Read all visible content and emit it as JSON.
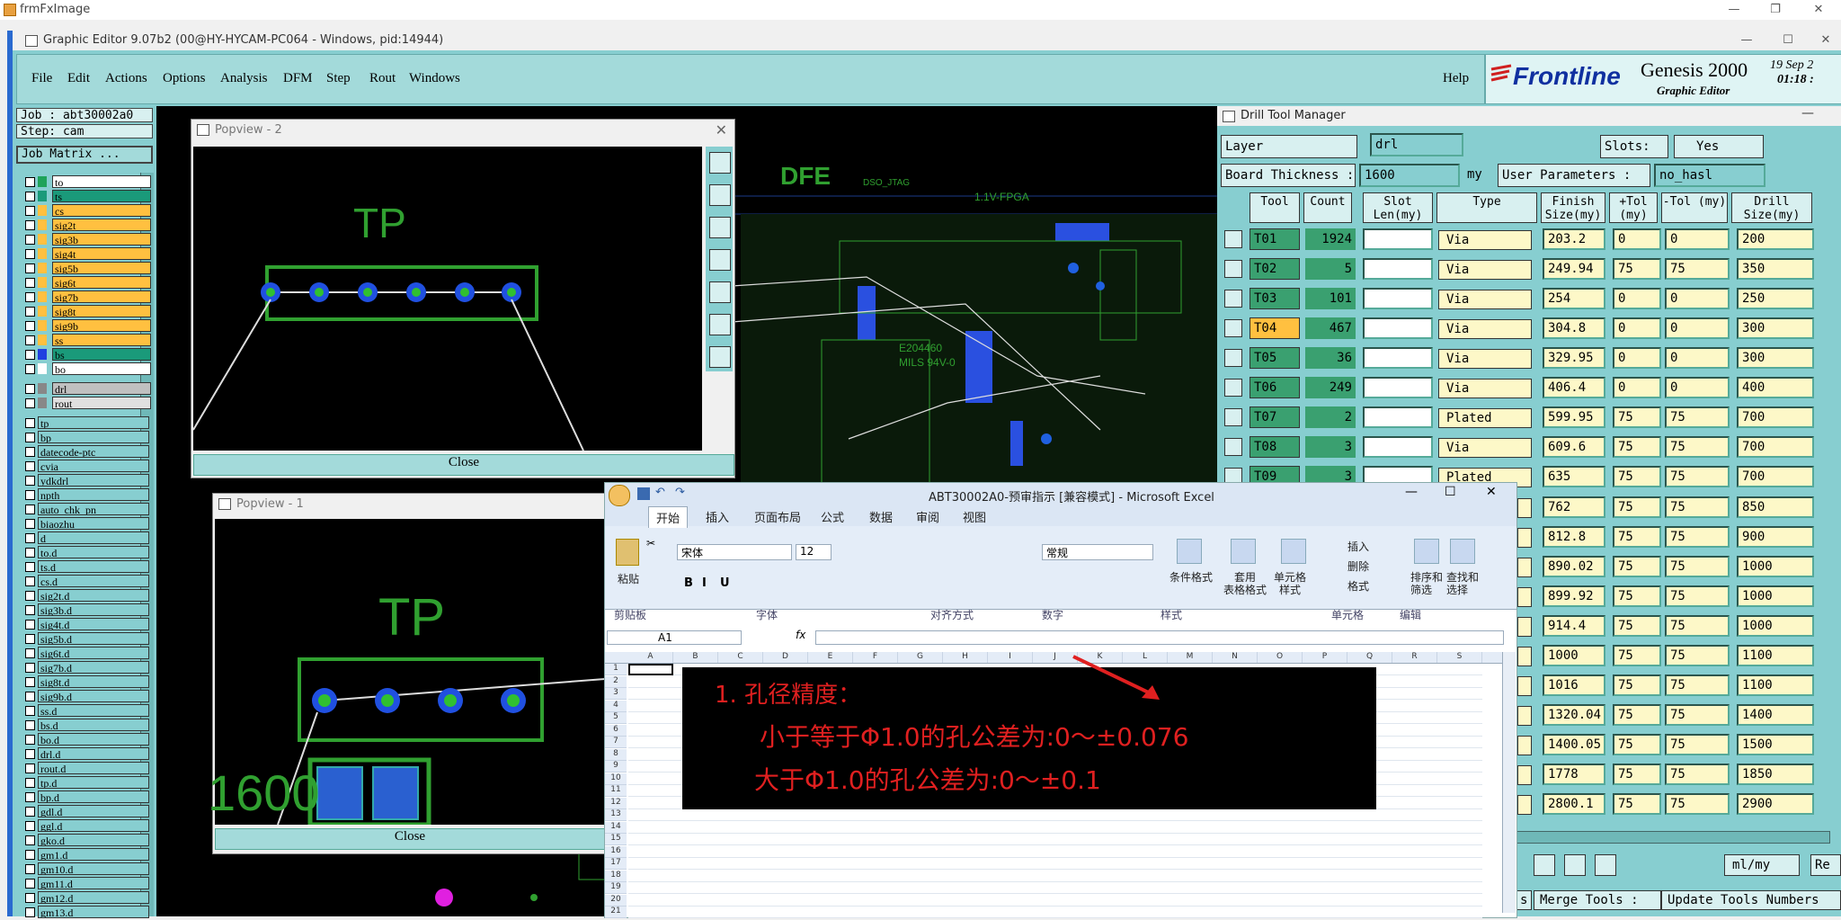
{
  "outer_window": {
    "title": "frmFxImage"
  },
  "app": {
    "title": "Graphic Editor 9.07b2 (00@HY-HYCAM-PC064 - Windows, pid:14944)",
    "menu": [
      "File",
      "Edit",
      "Actions",
      "Options",
      "Analysis",
      "DFM",
      "Step",
      "Rout",
      "Windows"
    ],
    "help": "Help",
    "logo": {
      "brand": "Frontline",
      "product": "Genesis 2000",
      "subtitle": "Graphic Editor",
      "date": "19 Sep 2",
      "time": "01:18 :"
    }
  },
  "left_panel": {
    "job": "Job : abt30002a0",
    "step": "Step: cam",
    "job_matrix": "Job Matrix ...",
    "layers": [
      {
        "name": "to",
        "color": "#1fa35a",
        "bg": "#ffffff"
      },
      {
        "name": "ts",
        "color": "#1a9a7a",
        "bg": "#1a9a7a"
      },
      {
        "name": "cs",
        "color": "#ffc040",
        "bg": "#ffc040"
      },
      {
        "name": "sig2t",
        "color": "#ffc040",
        "bg": "#ffc040"
      },
      {
        "name": "sig3b",
        "color": "#ffc040",
        "bg": "#ffc040"
      },
      {
        "name": "sig4t",
        "color": "#ffc040",
        "bg": "#ffc040"
      },
      {
        "name": "sig5b",
        "color": "#ffc040",
        "bg": "#ffc040"
      },
      {
        "name": "sig6t",
        "color": "#ffc040",
        "bg": "#ffc040"
      },
      {
        "name": "sig7b",
        "color": "#ffc040",
        "bg": "#ffc040"
      },
      {
        "name": "sig8t",
        "color": "#ffc040",
        "bg": "#ffc040"
      },
      {
        "name": "sig9b",
        "color": "#ffc040",
        "bg": "#ffc040"
      },
      {
        "name": "ss",
        "color": "#ffc040",
        "bg": "#ffc040"
      },
      {
        "name": "bs",
        "color": "#2040e0",
        "bg": "#1a9a7a"
      },
      {
        "name": "bo",
        "color": "#ffffff",
        "bg": "#ffffff"
      },
      {
        "name": "drl",
        "color": "#888888",
        "bg": "#c0c0c0"
      },
      {
        "name": "rout",
        "color": "#888888",
        "bg": "#e0e0e0"
      },
      {
        "name": "tp",
        "color": "",
        "bg": "#87ced0"
      },
      {
        "name": "bp",
        "color": "",
        "bg": "#87ced0"
      },
      {
        "name": "datecode-ptc",
        "color": "",
        "bg": "#87ced0"
      },
      {
        "name": "cvia",
        "color": "",
        "bg": "#87ced0"
      },
      {
        "name": "ydkdrl",
        "color": "",
        "bg": "#87ced0"
      },
      {
        "name": "npth",
        "color": "",
        "bg": "#87ced0"
      },
      {
        "name": "auto_chk_pn",
        "color": "",
        "bg": "#87ced0"
      },
      {
        "name": "biaozhu",
        "color": "",
        "bg": "#87ced0"
      },
      {
        "name": "d",
        "color": "",
        "bg": "#87ced0"
      },
      {
        "name": "to.d",
        "color": "",
        "bg": "#87ced0"
      },
      {
        "name": "ts.d",
        "color": "",
        "bg": "#87ced0"
      },
      {
        "name": "cs.d",
        "color": "",
        "bg": "#87ced0"
      },
      {
        "name": "sig2t.d",
        "color": "",
        "bg": "#87ced0"
      },
      {
        "name": "sig3b.d",
        "color": "",
        "bg": "#87ced0"
      },
      {
        "name": "sig4t.d",
        "color": "",
        "bg": "#87ced0"
      },
      {
        "name": "sig5b.d",
        "color": "",
        "bg": "#87ced0"
      },
      {
        "name": "sig6t.d",
        "color": "",
        "bg": "#87ced0"
      },
      {
        "name": "sig7b.d",
        "color": "",
        "bg": "#87ced0"
      },
      {
        "name": "sig8t.d",
        "color": "",
        "bg": "#87ced0"
      },
      {
        "name": "sig9b.d",
        "color": "",
        "bg": "#87ced0"
      },
      {
        "name": "ss.d",
        "color": "",
        "bg": "#87ced0"
      },
      {
        "name": "bs.d",
        "color": "",
        "bg": "#87ced0"
      },
      {
        "name": "bo.d",
        "color": "",
        "bg": "#87ced0"
      },
      {
        "name": "drl.d",
        "color": "",
        "bg": "#87ced0"
      },
      {
        "name": "rout.d",
        "color": "",
        "bg": "#87ced0"
      },
      {
        "name": "tp.d",
        "color": "",
        "bg": "#87ced0"
      },
      {
        "name": "bp.d",
        "color": "",
        "bg": "#87ced0"
      },
      {
        "name": "gdl.d",
        "color": "",
        "bg": "#87ced0"
      },
      {
        "name": "ggl.d",
        "color": "",
        "bg": "#87ced0"
      },
      {
        "name": "gko.d",
        "color": "",
        "bg": "#87ced0"
      },
      {
        "name": "gm1.d",
        "color": "",
        "bg": "#87ced0"
      },
      {
        "name": "gm10.d",
        "color": "",
        "bg": "#87ced0"
      },
      {
        "name": "gm11.d",
        "color": "",
        "bg": "#87ced0"
      },
      {
        "name": "gm12.d",
        "color": "",
        "bg": "#87ced0"
      },
      {
        "name": "gm13.d",
        "color": "",
        "bg": "#87ced0"
      }
    ]
  },
  "popview2": {
    "title": "Popview - 2",
    "label": "TP",
    "close": "Close"
  },
  "popview1": {
    "title": "Popview - 1",
    "label": "TP",
    "text_1600": "1600",
    "close": "Close"
  },
  "board_text": {
    "logo": "DFE",
    "ul": "E204460",
    "ul2": "MILS 94V-0",
    "fpga": "1.1V-FPGA",
    "jtag": "DSO_JTAG"
  },
  "drill_tool_manager": {
    "title": "Drill Tool Manager",
    "layer_label": "Layer",
    "layer_value": "drl",
    "slots_label": "Slots:",
    "slots_value": "Yes",
    "board_thickness_label": "Board Thickness :",
    "board_thickness_value": "1600",
    "board_thickness_unit": "my",
    "user_params_label": "User Parameters :",
    "user_params_value": "no_hasl",
    "headers": [
      "Tool",
      "Count",
      "Slot Len(my)",
      "Type",
      "Finish Size(my)",
      "+Tol (my)",
      "-Tol (my)",
      "Drill Size(my)"
    ],
    "rows": [
      {
        "tool": "T01",
        "count": "1924",
        "type": "Via",
        "finish": "203.2",
        "ptol": "0",
        "ntol": "0",
        "drill": "200"
      },
      {
        "tool": "T02",
        "count": "5",
        "type": "Via",
        "finish": "249.94",
        "ptol": "75",
        "ntol": "75",
        "drill": "350"
      },
      {
        "tool": "T03",
        "count": "101",
        "type": "Via",
        "finish": "254",
        "ptol": "0",
        "ntol": "0",
        "drill": "250"
      },
      {
        "tool": "T04",
        "count": "467",
        "type": "Via",
        "finish": "304.8",
        "ptol": "0",
        "ntol": "0",
        "drill": "300"
      },
      {
        "tool": "T05",
        "count": "36",
        "type": "Via",
        "finish": "329.95",
        "ptol": "0",
        "ntol": "0",
        "drill": "300"
      },
      {
        "tool": "T06",
        "count": "249",
        "type": "Via",
        "finish": "406.4",
        "ptol": "0",
        "ntol": "0",
        "drill": "400"
      },
      {
        "tool": "T07",
        "count": "2",
        "type": "Plated",
        "finish": "599.95",
        "ptol": "75",
        "ntol": "75",
        "drill": "700"
      },
      {
        "tool": "T08",
        "count": "3",
        "type": "Via",
        "finish": "609.6",
        "ptol": "75",
        "ntol": "75",
        "drill": "700"
      },
      {
        "tool": "T09",
        "count": "3",
        "type": "Plated",
        "finish": "635",
        "ptol": "75",
        "ntol": "75",
        "drill": "700"
      }
    ],
    "hidden_rows": [
      {
        "finish": "762",
        "ptol": "75",
        "ntol": "75",
        "drill": "850"
      },
      {
        "finish": "812.8",
        "ptol": "75",
        "ntol": "75",
        "drill": "900"
      },
      {
        "finish": "890.02",
        "ptol": "75",
        "ntol": "75",
        "drill": "1000"
      },
      {
        "finish": "899.92",
        "ptol": "75",
        "ntol": "75",
        "drill": "1000"
      },
      {
        "finish": "914.4",
        "ptol": "75",
        "ntol": "75",
        "drill": "1000"
      },
      {
        "finish": "1000",
        "ptol": "75",
        "ntol": "75",
        "drill": "1100"
      },
      {
        "finish": "1016",
        "ptol": "75",
        "ntol": "75",
        "drill": "1100"
      },
      {
        "finish": "1320.04",
        "ptol": "75",
        "ntol": "75",
        "drill": "1400"
      },
      {
        "finish": "1400.05",
        "ptol": "75",
        "ntol": "75",
        "drill": "1500"
      },
      {
        "finish": "1778",
        "ptol": "75",
        "ntol": "75",
        "drill": "1850"
      },
      {
        "finish": "2800.1",
        "ptol": "75",
        "ntol": "75",
        "drill": "2900"
      }
    ],
    "unit_select": "ml/my",
    "merge_tools": "Merge Tools :",
    "update_tools": "Update Tools Numbers",
    "truncated_s": "s",
    "truncated_re": "Re"
  },
  "excel": {
    "title": "ABT30002A0-预审指示  [兼容模式] - Microsoft Excel",
    "tabs": [
      "开始",
      "插入",
      "页面布局",
      "公式",
      "数据",
      "审阅",
      "视图"
    ],
    "font_name": "宋体",
    "font_size": "12",
    "number_format": "常规",
    "paste": "粘贴",
    "groups": [
      "剪贴板",
      "字体",
      "对齐方式",
      "数字",
      "样式",
      "单元格",
      "编辑"
    ],
    "styles_buttons": [
      "条件格式",
      "套用\n表格格式",
      "单元格\n样式"
    ],
    "cells_buttons": [
      "插入",
      "删除",
      "格式"
    ],
    "edit_buttons": [
      "排序和\n筛选",
      "查找和\n选择"
    ],
    "name_box": "A1",
    "columns": [
      "A",
      "B",
      "C",
      "D",
      "E",
      "F",
      "G",
      "H",
      "I",
      "J",
      "K",
      "L",
      "M",
      "N",
      "O",
      "P",
      "Q",
      "R",
      "S"
    ],
    "rows": [
      "1",
      "2",
      "3",
      "4",
      "5",
      "6",
      "7",
      "8",
      "9",
      "10",
      "11",
      "12",
      "13",
      "14",
      "15",
      "16",
      "17",
      "18",
      "19",
      "20",
      "21"
    ],
    "note_line1": "1.  孔径精度：",
    "note_line2": "小于等于Φ1.0的孔公差为:0～±0.076",
    "note_line3": "大于Φ1.0的孔公差为:0～±0.1"
  }
}
